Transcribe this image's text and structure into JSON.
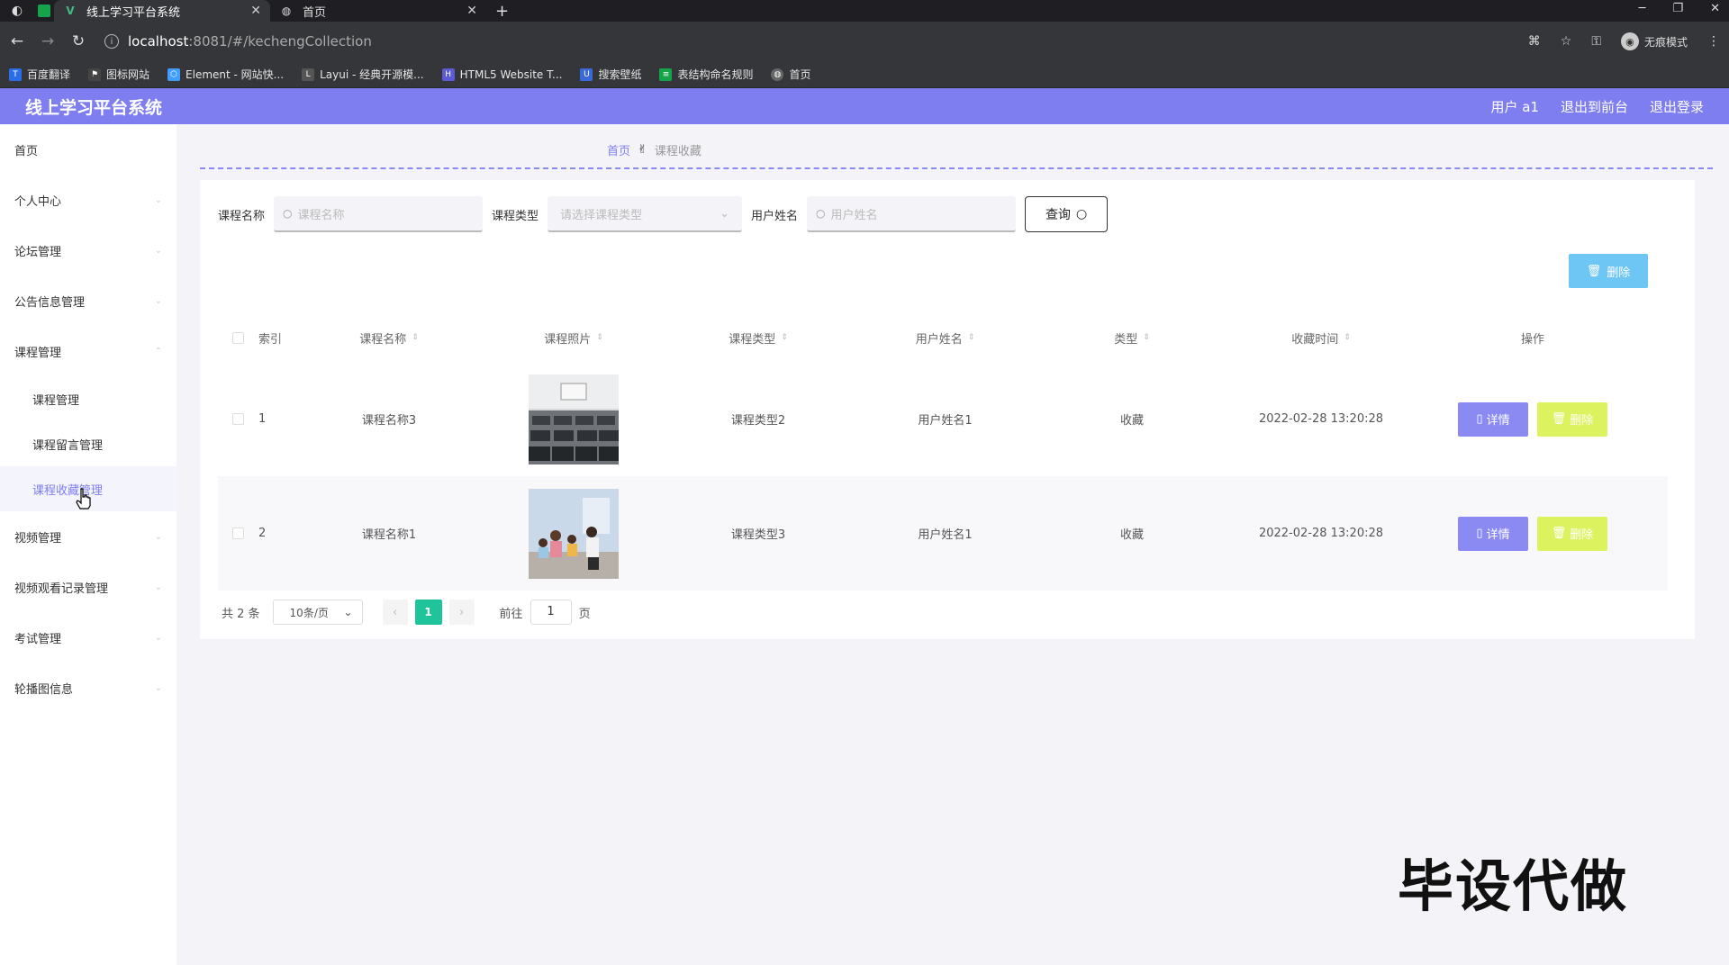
{
  "browser": {
    "tabs": [
      {
        "title": "线上学习平台系统",
        "active": true
      },
      {
        "title": "首页",
        "active": false
      }
    ],
    "url_host": "localhost",
    "url_path": ":8081/#/kechengCollection",
    "incognito_label": "无痕模式",
    "bookmarks": [
      {
        "label": "百度翻译",
        "color": "#2b6de5"
      },
      {
        "label": "图标网站",
        "color": "#444444"
      },
      {
        "label": "Element - 网站快...",
        "color": "#409eff"
      },
      {
        "label": "Layui - 经典开源模...",
        "color": "#555555"
      },
      {
        "label": "HTML5 Website T...",
        "color": "#5b5bd6"
      },
      {
        "label": "搜索壁纸",
        "color": "#3a6ad9"
      },
      {
        "label": "表结构命名规则",
        "color": "#16a34a"
      },
      {
        "label": "首页",
        "color": "#666666"
      }
    ]
  },
  "header": {
    "title": "线上学习平台系统",
    "user": "用户 a1",
    "back_front": "退出到前台",
    "logout": "退出登录"
  },
  "sidebar": {
    "items": [
      {
        "label": "首页"
      },
      {
        "label": "个人中心"
      },
      {
        "label": "论坛管理"
      },
      {
        "label": "公告信息管理"
      },
      {
        "label": "课程管理"
      }
    ],
    "sub_items": [
      {
        "label": "课程管理"
      },
      {
        "label": "课程留言管理"
      },
      {
        "label": "课程收藏管理"
      }
    ],
    "items_after": [
      {
        "label": "视频管理"
      },
      {
        "label": "视频观看记录管理"
      },
      {
        "label": "考试管理"
      },
      {
        "label": "轮播图信息"
      }
    ]
  },
  "breadcrumb": {
    "home": "首页",
    "current": "课程收藏"
  },
  "search": {
    "name_label": "课程名称",
    "name_placeholder": "课程名称",
    "type_label": "课程类型",
    "type_placeholder": "请选择课程类型",
    "user_label": "用户姓名",
    "user_placeholder": "用户姓名",
    "query_button": "查询"
  },
  "toolbar": {
    "delete_label": "删除"
  },
  "table": {
    "headers": [
      "索引",
      "课程名称",
      "课程照片",
      "课程类型",
      "用户姓名",
      "类型",
      "收藏时间",
      "操作"
    ],
    "rows": [
      {
        "index": "1",
        "name": "课程名称3",
        "type": "课程类型2",
        "user": "用户姓名1",
        "kind": "收藏",
        "time": "2022-02-28 13:20:28",
        "detail": "详情",
        "delete": "删除"
      },
      {
        "index": "2",
        "name": "课程名称1",
        "type": "课程类型3",
        "user": "用户姓名1",
        "kind": "收藏",
        "time": "2022-02-28 13:20:28",
        "detail": "详情",
        "delete": "删除"
      }
    ]
  },
  "pagination": {
    "total": "共 2 条",
    "page_size": "10条/页",
    "current_page": "1",
    "goto_prefix": "前往",
    "goto_value": "1",
    "goto_suffix": "页"
  },
  "watermark": "毕设代做",
  "colors": {
    "accent": "#7e7ef0",
    "detail_btn": "#8a8af2",
    "delete_btn": "#dcf25e",
    "top_delete": "#6ec6f5",
    "page_active": "#1fc49a"
  }
}
